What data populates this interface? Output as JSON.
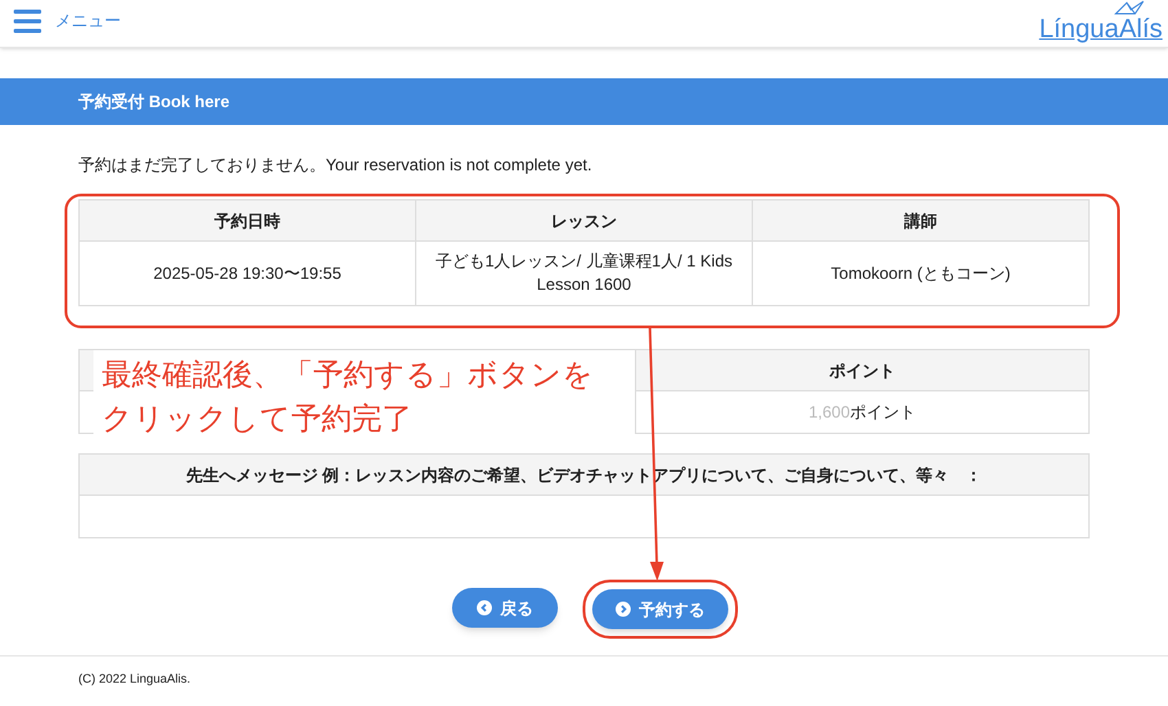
{
  "header": {
    "menu_label": "メニュー",
    "logo": "LínguaAlís"
  },
  "title_bar": "予約受付 Book here",
  "notice": "予約はまだ完了しておりません。Your reservation is not complete yet.",
  "booking_table": {
    "columns": [
      "予約日時",
      "レッスン",
      "講師"
    ],
    "row": [
      "2025-05-28 19:30〜19:55",
      "子ども1人レッスン/ 儿童课程1人/ 1 Kids Lesson 1600",
      "Tomokoorn (ともコーン)"
    ]
  },
  "points_table": {
    "column": "ポイント",
    "amount": "1,600",
    "unit": "ポイント"
  },
  "message_table": {
    "label": "先生へメッセージ 例：レッスン内容のご希望、ビデオチャットアプリについて、ご自身について、等々　："
  },
  "buttons": [
    {
      "label": "戻る",
      "highlighted": false
    },
    {
      "label": "予約する",
      "highlighted": true
    }
  ],
  "annotation": {
    "lines": [
      "最終確認後、「予約する」ボタンを",
      "クリックして予約完了"
    ]
  },
  "footer": "(C) 2022 LinguaAlis."
}
